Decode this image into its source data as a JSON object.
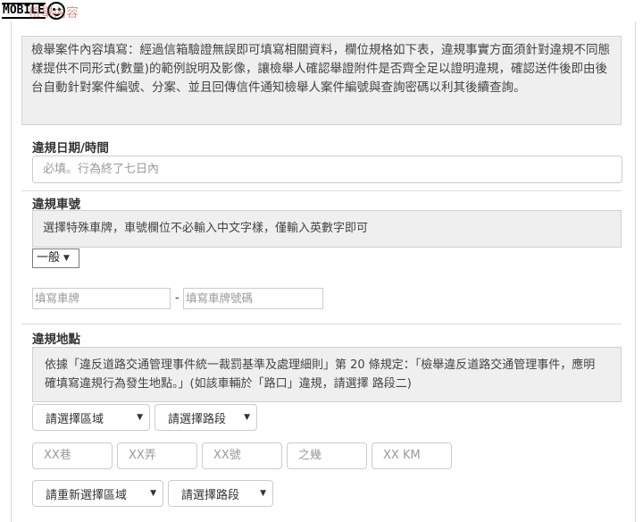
{
  "header": {
    "logo_text": "MOBILE",
    "title": "檢舉內容"
  },
  "notice": {
    "text": "檢舉案件內容填寫：經過信箱驗證無誤即可填寫相關資料，欄位規格如下表，違規事實方面須針對違規不同態樣提供不同形式(數量)的範例說明及影像，讓檢舉人確認舉證附件是否齊全足以證明違規，確認送件後即由後台自動針對案件編號、分案、並且回傳信件通知檢舉人案件編號與查詢密碼以利其後續查詢。"
  },
  "violation_datetime": {
    "label": "違規日期/時間",
    "placeholder": "必填。行為終了七日內"
  },
  "plate": {
    "label": "違規車號",
    "hint": "選擇特殊車牌，車號欄位不必輸入中文字樣，僅輸入英數字即可",
    "type_selected": "一般",
    "prefix_placeholder": "填寫車牌",
    "separator": "-",
    "number_placeholder": "填寫車牌號碼"
  },
  "location": {
    "label": "違規地點",
    "hint": "依據「違反道路交通管理事件統一裁罰基準及處理細則」第 20 條規定：「檢舉違反道路交通管理事件，應明確填寫違規行為發生地點。」(如該車輛於「路口」違規，請選擇 路段二)",
    "district_select": "請選擇區域",
    "road_select": "請選擇路段",
    "lane_placeholder": "XX巷",
    "alley_placeholder": "XX弄",
    "number_placeholder": "XX號",
    "sub_placeholder": "之幾",
    "km_placeholder": "XX KM",
    "district_select_2": "請重新選擇區域",
    "road_select_2": "請選擇路段"
  }
}
